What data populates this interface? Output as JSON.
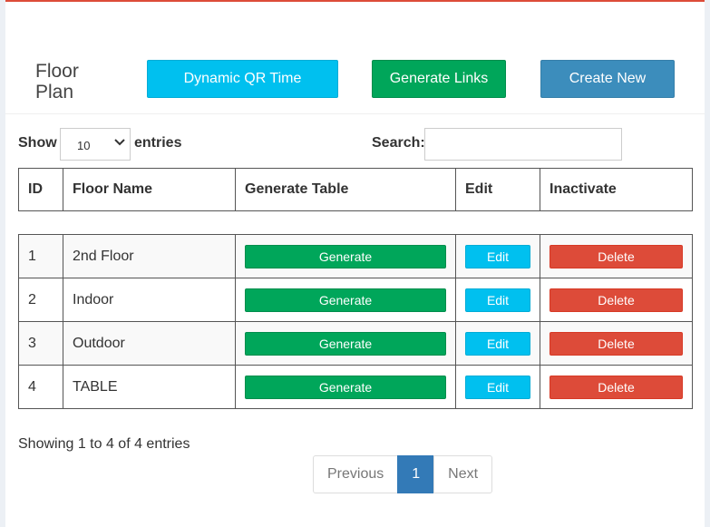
{
  "header": {
    "title": "Floor Plan",
    "buttons": {
      "dynamic_qr_time": "Dynamic QR Time",
      "generate_links": "Generate Links",
      "create_new": "Create New"
    }
  },
  "controls": {
    "show_label": "Show",
    "length_value": "10",
    "entries_label": "entries",
    "search_label": "Search:",
    "search_value": ""
  },
  "table": {
    "columns": [
      "ID",
      "Floor Name",
      "Generate Table",
      "Edit",
      "Inactivate"
    ],
    "rows": [
      {
        "id": "1",
        "name": "2nd Floor",
        "generate": "Generate",
        "edit": "Edit",
        "delete": "Delete"
      },
      {
        "id": "2",
        "name": "Indoor",
        "generate": "Generate",
        "edit": "Edit",
        "delete": "Delete"
      },
      {
        "id": "3",
        "name": "Outdoor",
        "generate": "Generate",
        "edit": "Edit",
        "delete": "Delete"
      },
      {
        "id": "4",
        "name": "TABLE",
        "generate": "Generate",
        "edit": "Edit",
        "delete": "Delete"
      }
    ]
  },
  "footer": {
    "info": "Showing 1 to 4 of 4 entries",
    "pagination": {
      "previous": "Previous",
      "current": "1",
      "next": "Next"
    }
  },
  "colors": {
    "info": "#00c0ef",
    "success": "#00a65a",
    "primary": "#3c8dbc",
    "danger": "#dd4b39",
    "page_active": "#337ab7"
  }
}
